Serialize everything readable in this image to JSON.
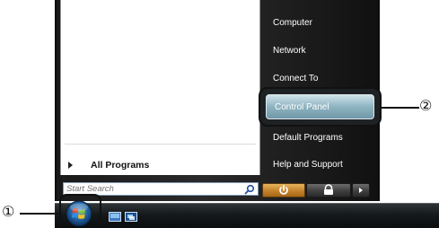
{
  "start_menu": {
    "left_pane": {
      "all_programs_label": "All Programs",
      "search_placeholder": "Start Search"
    },
    "right_pane": {
      "items": [
        {
          "label": "Computer"
        },
        {
          "label": "Network"
        },
        {
          "label": "Connect To"
        },
        {
          "label": "Control Panel"
        },
        {
          "label": "Default Programs"
        },
        {
          "label": "Help and Support"
        }
      ]
    },
    "power_buttons": [
      {
        "icon": "power-icon"
      },
      {
        "icon": "lock-icon"
      },
      {
        "icon": "arrow-right-icon"
      }
    ]
  },
  "taskbar": {
    "start_button_icon": "windows-orb-icon",
    "quick_launch": [
      {
        "icon": "show-desktop-icon"
      },
      {
        "icon": "switch-windows-icon"
      }
    ]
  },
  "annotations": {
    "callout_1": "①",
    "callout_2": "②"
  },
  "colors": {
    "menu_background": "#1f2224",
    "highlight": "#8eb3c1",
    "power_button": "#c4822a"
  }
}
